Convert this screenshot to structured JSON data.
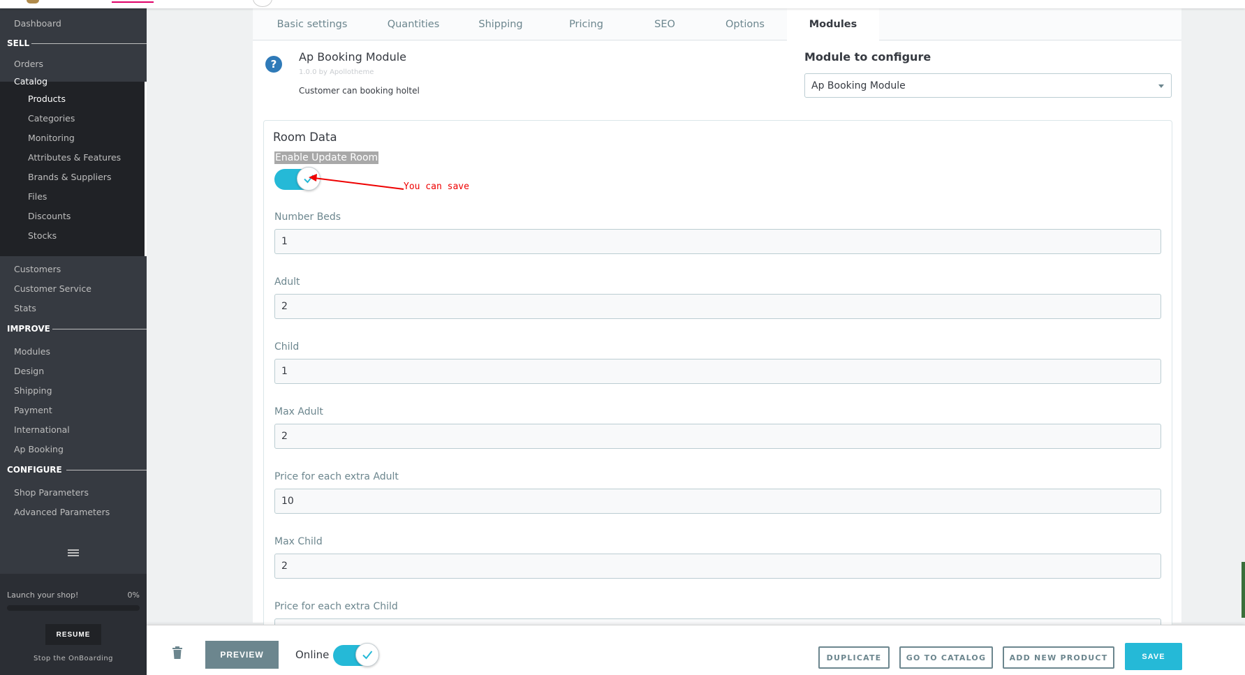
{
  "sidebar": {
    "dashboard": "Dashboard",
    "sections": {
      "sell": "SELL",
      "improve": "IMPROVE",
      "configure": "CONFIGURE"
    },
    "sell_items": {
      "orders": "Orders",
      "catalog": "Catalog",
      "customers": "Customers",
      "customer_service": "Customer Service",
      "stats": "Stats"
    },
    "catalog_items": [
      "Products",
      "Categories",
      "Monitoring",
      "Attributes & Features",
      "Brands & Suppliers",
      "Files",
      "Discounts",
      "Stocks"
    ],
    "improve_items": [
      "Modules",
      "Design",
      "Shipping",
      "Payment",
      "International",
      "Ap Booking"
    ],
    "configure_items": [
      "Shop Parameters",
      "Advanced Parameters"
    ],
    "launch": {
      "label": "Launch your shop!",
      "percent": "0%",
      "progress": 0
    },
    "resume_label": "RESUME",
    "stop_label": "Stop the OnBoarding"
  },
  "tabs": [
    "Basic settings",
    "Quantities",
    "Shipping",
    "Pricing",
    "SEO",
    "Options",
    "Modules"
  ],
  "module": {
    "name": "Ap Booking Module",
    "version": "1.0.0 by Apollotheme",
    "description": "Customer can booking holtel",
    "configure_label": "Module to configure",
    "configure_value": "Ap Booking Module"
  },
  "room_data": {
    "title": "Room Data",
    "enable_label": "Enable Update Room",
    "enable_on": true,
    "annotation": "You can save",
    "fields": [
      {
        "label": "Number Beds",
        "value": "1"
      },
      {
        "label": "Adult",
        "value": "2"
      },
      {
        "label": "Child",
        "value": "1"
      },
      {
        "label": "Max Adult",
        "value": "2"
      },
      {
        "label": "Price for each extra Adult",
        "value": "10"
      },
      {
        "label": "Max Child",
        "value": "2"
      },
      {
        "label": "Price for each extra Child",
        "value": ""
      }
    ]
  },
  "footer": {
    "preview": "PREVIEW",
    "online": "Online",
    "online_on": true,
    "duplicate": "DUPLICATE",
    "go_to_catalog": "GO TO CATALOG",
    "add_new_product": "ADD NEW PRODUCT",
    "save": "SAVE"
  },
  "colors": {
    "accent": "#25b9d7",
    "sidebar": "#363a41",
    "sidebar_active": "#202226",
    "annotation": "#ee0000"
  },
  "icons": [
    "help-icon",
    "caret-down-icon",
    "check-icon",
    "hamburger-icon",
    "trash-icon"
  ]
}
